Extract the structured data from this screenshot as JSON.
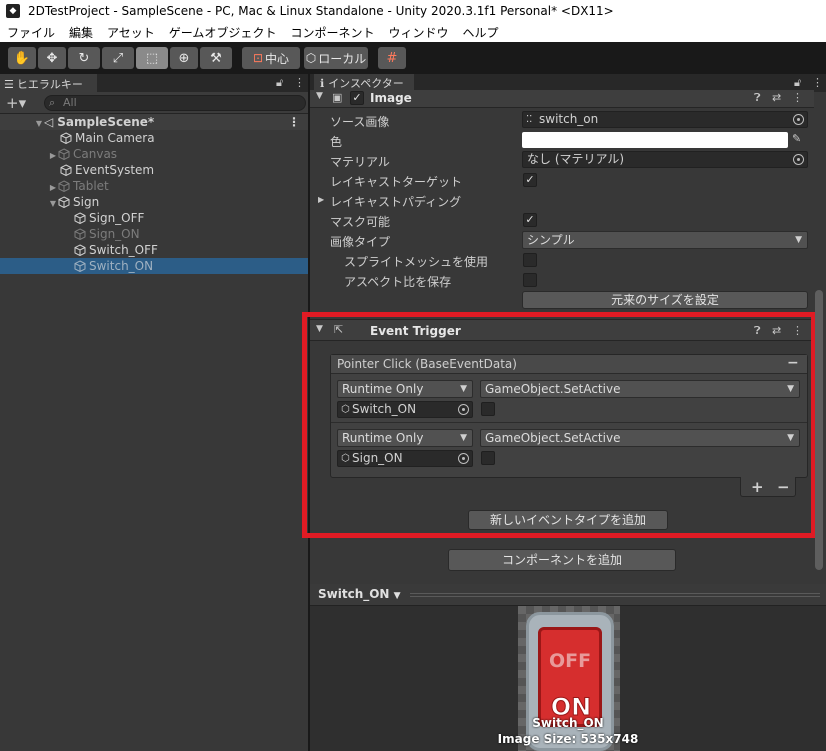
{
  "window": {
    "title": "2DTestProject - SampleScene - PC, Mac & Linux Standalone - Unity 2020.3.1f1 Personal* <DX11>"
  },
  "menu": [
    "ファイル",
    "編集",
    "アセット",
    "ゲームオブジェクト",
    "コンポーネント",
    "ウィンドウ",
    "ヘルプ"
  ],
  "toolbar": {
    "pivot_label": "中心",
    "space_label": "ローカル"
  },
  "hierarchy": {
    "tab_label": "ヒエラルキー",
    "search_placeholder": "All",
    "items": [
      {
        "label": "SampleScene*"
      },
      {
        "label": "Main Camera"
      },
      {
        "label": "Canvas"
      },
      {
        "label": "EventSystem"
      },
      {
        "label": "Tablet"
      },
      {
        "label": "Sign"
      },
      {
        "label": "Sign_OFF"
      },
      {
        "label": "Sign_ON"
      },
      {
        "label": "Switch_OFF"
      },
      {
        "label": "Switch_ON"
      }
    ]
  },
  "inspector": {
    "tab_label": "インスペクター",
    "image_component": {
      "title": "Image",
      "source_image_label": "ソース画像",
      "source_image_value": "switch_on",
      "color_label": "色",
      "material_label": "マテリアル",
      "material_value": "なし (マテリアル)",
      "raycast_target_label": "レイキャストターゲット",
      "raycast_padding_label": "レイキャストパディング",
      "maskable_label": "マスク可能",
      "image_type_label": "画像タイプ",
      "image_type_value": "シンプル",
      "use_sprite_mesh_label": "スプライトメッシュを使用",
      "preserve_aspect_label": "アスペクト比を保存",
      "set_native_size_button": "元来のサイズを設定"
    },
    "event_trigger": {
      "title": "Event Trigger",
      "event_header": "Pointer Click (BaseEventData)",
      "minus_label": "−",
      "entries": [
        {
          "runtime": "Runtime Only",
          "function": "GameObject.SetActive",
          "object": "Switch_ON"
        },
        {
          "runtime": "Runtime Only",
          "function": "GameObject.SetActive",
          "object": "Sign_ON"
        }
      ],
      "plus_label": "+",
      "minus2_label": "−",
      "add_event_button": "新しいイベントタイプを追加"
    },
    "add_component_button": "コンポーネントを追加"
  },
  "preview": {
    "object_label": "Switch_ON",
    "off_text": "OFF",
    "on_text": "ON",
    "caption_name": "Switch_ON",
    "caption_size": "Image Size: 535x748"
  }
}
